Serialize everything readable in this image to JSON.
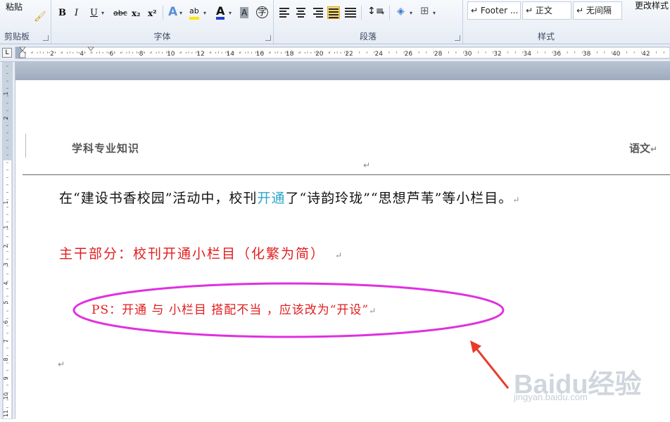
{
  "ribbon": {
    "clipboard": {
      "paste_label": "粘贴",
      "group_label": "剪贴板"
    },
    "font": {
      "group_label": "字体",
      "bold": "B",
      "italic": "I",
      "underline": "U",
      "strike": "abc",
      "subscript": "x₂",
      "superscript": "x²",
      "text_effect": "A",
      "highlight": "ab",
      "font_color": "A",
      "char_shading": "A",
      "enclose": "字"
    },
    "paragraph": {
      "group_label": "段落"
    },
    "styles": {
      "group_label": "样式",
      "items": [
        "↵ Footer ...",
        "↵ 正文",
        "↵ 无间隔"
      ],
      "change_styles": "更改样式"
    }
  },
  "ruler": {
    "labels": [
      "2",
      "4",
      "6",
      "8",
      "10",
      "12",
      "14",
      "16",
      "18",
      "20",
      "22",
      "24",
      "26",
      "28",
      "30",
      "32",
      "34",
      "36",
      "38",
      "40",
      "42"
    ]
  },
  "vruler": {
    "labels": [
      "1",
      "2",
      "1",
      "1",
      "2",
      "3",
      "4",
      "5",
      "6",
      "7",
      "8",
      "9",
      "10",
      "11"
    ]
  },
  "document": {
    "header_left": "学科专业知识",
    "header_right": "语文",
    "paragraph_mark": "↵",
    "line1_before": "在“建设书香校园”活动中，校刊",
    "line1_highlight": "开通",
    "line1_after": "了“诗韵玲珑”“思想芦苇”等小栏目。",
    "line2": "主干部分：校刊开通小栏目（化繁为简）",
    "ps_line": "PS：开通 与 小栏目  搭配不当 ，应该改为“开设”"
  },
  "annotations": {
    "ellipse_color": "#e030e0",
    "arrow_color": "#e83a2a"
  },
  "watermark": {
    "text": "Baidu经验",
    "sub": "jingyan.baidu.com"
  }
}
